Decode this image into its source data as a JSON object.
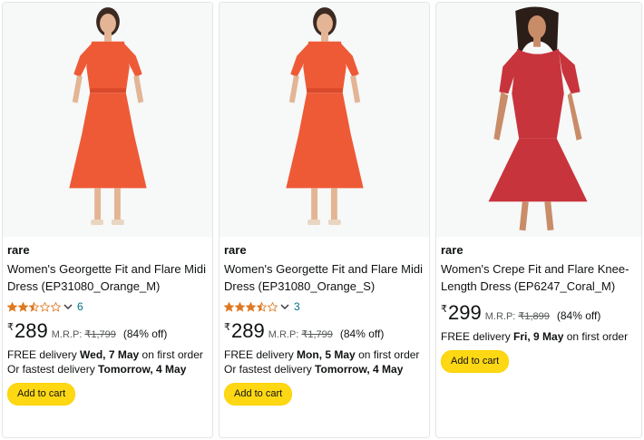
{
  "products": [
    {
      "brand": "rare",
      "title_line1": "Women's Georgette Fit and Flare Midi",
      "title_line2": "Dress (EP31080_Orange_M)",
      "rating": 2.5,
      "rating_count": "6",
      "currency": "₹",
      "price": "289",
      "mrp_label": "M.R.P:",
      "mrp": "₹1,799",
      "discount": "(84% off)",
      "delivery_prefix": "FREE delivery",
      "delivery_date": "Wed, 7 May",
      "delivery_suffix": "on first order",
      "fastest_prefix": "Or fastest delivery",
      "fastest_date": "Tomorrow, 4 May",
      "button": "Add to cart",
      "dress_color": "#ee5a36"
    },
    {
      "brand": "rare",
      "title_line1": "Women's Georgette Fit and Flare Midi",
      "title_line2": "Dress (EP31080_Orange_S)",
      "rating": 3.5,
      "rating_count": "3",
      "currency": "₹",
      "price": "289",
      "mrp_label": "M.R.P:",
      "mrp": "₹1,799",
      "discount": "(84% off)",
      "delivery_prefix": "FREE delivery",
      "delivery_date": "Mon, 5 May",
      "delivery_suffix": "on first order",
      "fastest_prefix": "Or fastest delivery",
      "fastest_date": "Tomorrow, 4 May",
      "button": "Add to cart",
      "dress_color": "#ee5a36"
    },
    {
      "brand": "rare",
      "title_line1": "Women's Crepe Fit and Flare Knee-",
      "title_line2": "Length Dress (EP6247_Coral_M)",
      "currency": "₹",
      "price": "299",
      "mrp_label": "M.R.P:",
      "mrp": "₹1,899",
      "discount": "(84% off)",
      "delivery_prefix": "FREE delivery",
      "delivery_date": "Fri, 9 May",
      "delivery_suffix": "on first order",
      "button": "Add to cart",
      "dress_color": "#c8343c"
    }
  ],
  "colors": {
    "star": "#de7921",
    "star_empty": "#de7921",
    "link": "#007185",
    "button": "#ffd814",
    "border": "#e3e6e6",
    "image_bg": "#f7f8f8"
  },
  "icons": [
    "star-icon",
    "chevron-down-icon"
  ]
}
